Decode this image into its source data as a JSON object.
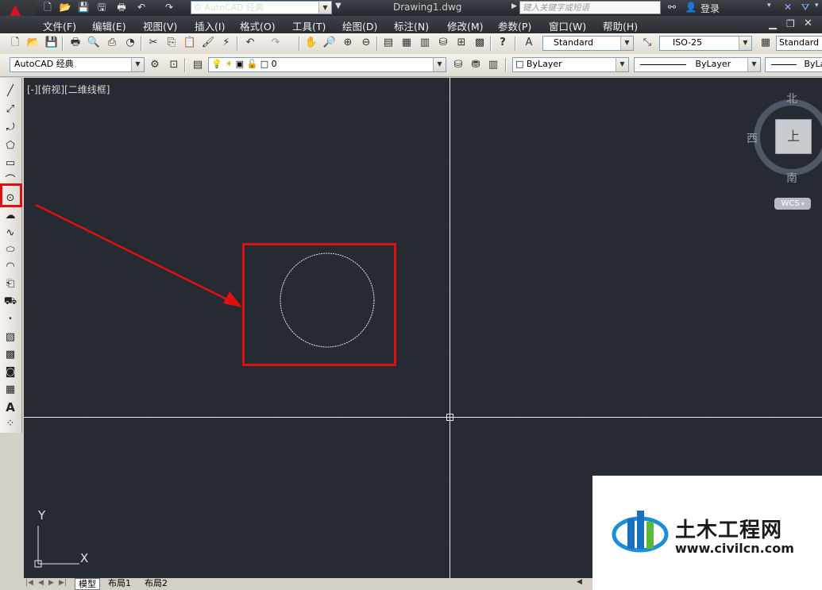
{
  "title": {
    "document": "Drawing1.dwg",
    "workspace": "AutoCAD 经典",
    "search_placeholder": "键入关键字或短语",
    "login": "登录"
  },
  "menu": [
    "文件(F)",
    "编辑(E)",
    "视图(V)",
    "插入(I)",
    "格式(O)",
    "工具(T)",
    "绘图(D)",
    "标注(N)",
    "修改(M)",
    "参数(P)",
    "窗口(W)",
    "帮助(H)"
  ],
  "styles": {
    "text_style": "Standard",
    "dim_style": "ISO-25",
    "table_style": "Standard"
  },
  "toolbar2": {
    "workspace": "AutoCAD 经典",
    "layer": "0",
    "color": "ByLayer",
    "linetype": "ByLayer",
    "lineweight": "ByLay"
  },
  "viewport": {
    "label": "[-][俯视][二维线框]",
    "compass": {
      "north": "北",
      "south": "南",
      "west": "西",
      "top": "上"
    },
    "ucs": "WCS",
    "axis_x": "X",
    "axis_y": "Y"
  },
  "tabs": [
    "模型",
    "布局1",
    "布局2"
  ],
  "watermark": {
    "title": "土木工程网",
    "url": "www.civilcn.com"
  },
  "colors": {
    "canvas": "#252a33",
    "highlight": "#e01010",
    "crosshair": "#ffffff"
  }
}
